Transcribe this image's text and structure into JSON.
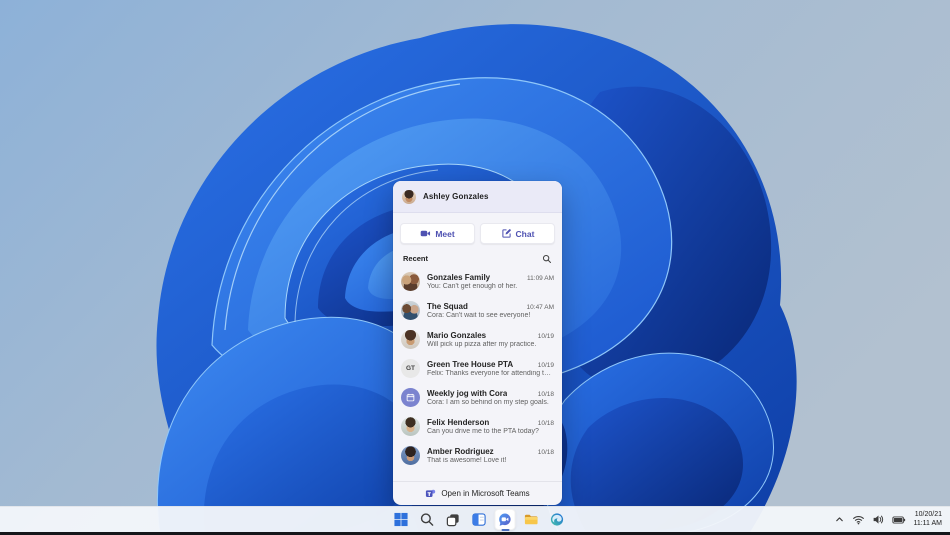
{
  "wallpaper": {
    "name": "windows-11-bloom",
    "bg_top_left": "#8db1d8",
    "bg_right": "#b2c1d0",
    "bloom_bright": "#3e8bf2",
    "bloom_dark": "#082674"
  },
  "chat_panel": {
    "header": {
      "name": "Ashley Gonzales"
    },
    "actions": {
      "meet_label": "Meet",
      "chat_label": "Chat"
    },
    "recent_label": "Recent",
    "conversations": [
      {
        "name": "Gonzales Family",
        "preview": "You: Can't get enough of her.",
        "time": "11:09 AM",
        "avatar": "photo-group"
      },
      {
        "name": "The Squad",
        "preview": "Cora: Can't wait to see everyone!",
        "time": "10:47 AM",
        "avatar": "photo-group"
      },
      {
        "name": "Mario Gonzales",
        "preview": "Will pick up pizza after my practice.",
        "time": "10/19",
        "avatar": "photo"
      },
      {
        "name": "Green Tree House PTA",
        "preview": "Felix: Thanks everyone for attending today.",
        "time": "10/19",
        "avatar": "initials",
        "initials": "GT"
      },
      {
        "name": "Weekly jog with Cora",
        "preview": "Cora: I am so behind on my step goals.",
        "time": "10/18",
        "avatar": "calendar"
      },
      {
        "name": "Felix Henderson",
        "preview": "Can you drive me to the PTA today?",
        "time": "10/18",
        "avatar": "photo"
      },
      {
        "name": "Amber Rodriguez",
        "preview": "That is awesome! Love it!",
        "time": "10/18",
        "avatar": "photo"
      }
    ],
    "footer_label": "Open in Microsoft Teams"
  },
  "taskbar": {
    "icons": [
      "start",
      "search",
      "task-view",
      "widgets",
      "chat",
      "file-explorer",
      "edge"
    ],
    "active_icon": "chat",
    "tray_icons": [
      "chevron-up",
      "wifi",
      "volume",
      "battery"
    ],
    "clock": {
      "date": "10/20/21",
      "time": "11:11 AM"
    }
  },
  "colors": {
    "teams_purple": "#4f52b2",
    "accent_blue": "#2e71dc"
  }
}
